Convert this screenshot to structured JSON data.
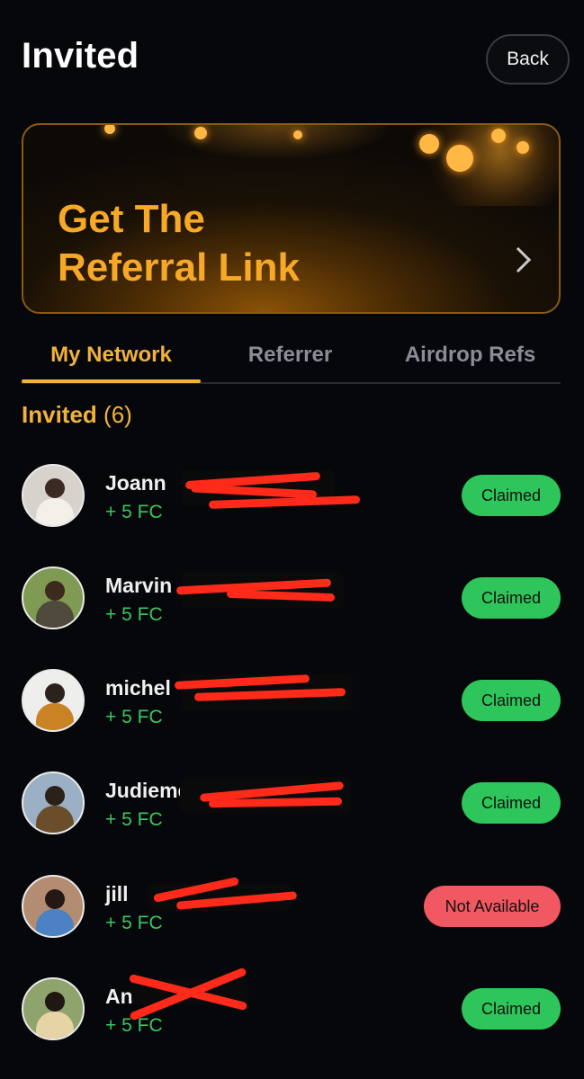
{
  "header": {
    "title": "Invited",
    "back_label": "Back"
  },
  "banner": {
    "line1": "Get The",
    "line2": "Referral Link",
    "icon": "chevron-right-icon"
  },
  "tabs": [
    {
      "label": "My Network",
      "active": true
    },
    {
      "label": "Referrer",
      "active": false
    },
    {
      "label": "Airdrop Refs",
      "active": false
    }
  ],
  "section": {
    "title": "Invited",
    "count": "(6)"
  },
  "colors": {
    "accent": "#f2b23a",
    "claimed": "#2ec65a",
    "not_available": "#f25861",
    "reward": "#39c860"
  },
  "invitees": [
    {
      "name": "Joann",
      "reward": "+ 5 FC",
      "status": "Claimed"
    },
    {
      "name": "Marvin",
      "reward": "+ 5 FC",
      "status": "Claimed"
    },
    {
      "name": "michel",
      "reward": "+ 5 FC",
      "status": "Claimed"
    },
    {
      "name": "Judieme",
      "reward": "+ 5 FC",
      "status": "Claimed"
    },
    {
      "name": "jill",
      "reward": "+ 5 FC",
      "status": "Not Available"
    },
    {
      "name": "An",
      "reward": "+ 5 FC",
      "status": "Claimed"
    }
  ]
}
